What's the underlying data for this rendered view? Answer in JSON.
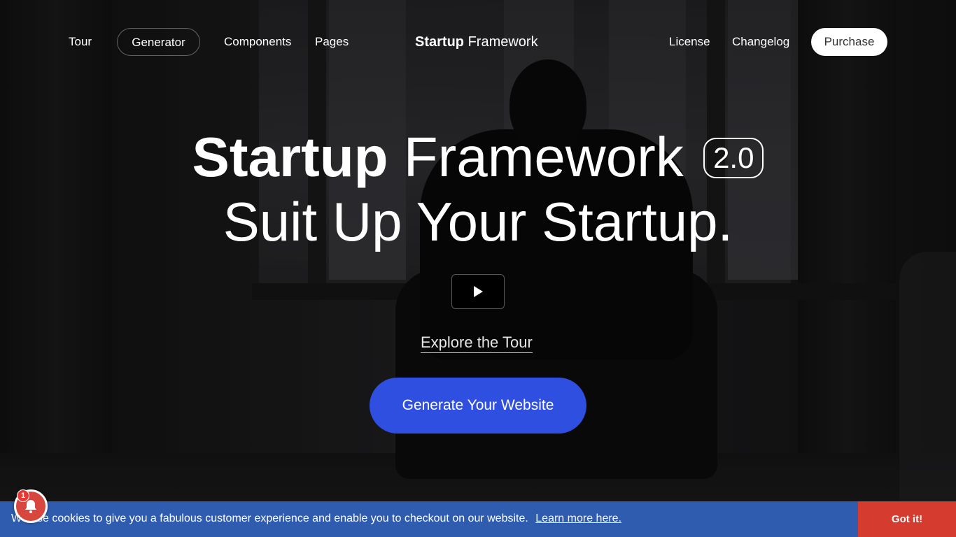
{
  "nav": {
    "left": [
      {
        "label": "Tour"
      },
      {
        "label": "Generator"
      },
      {
        "label": "Components"
      },
      {
        "label": "Pages"
      }
    ],
    "brand_bold": "Startup",
    "brand_light": "Framework",
    "right": [
      {
        "label": "License"
      },
      {
        "label": "Changelog"
      }
    ],
    "purchase_label": "Purchase"
  },
  "hero": {
    "title_bold": "Startup",
    "title_light": "Framework",
    "version": "2.0",
    "subtitle": "Suit Up Your Startup.",
    "play_icon": "play-icon",
    "explore_label": "Explore the Tour",
    "cta_label": "Generate Your Website"
  },
  "cookie": {
    "text": "We use cookies to give you a fabulous customer experience and enable you to checkout on our website.",
    "link_label": "Learn more here.",
    "button_label": "Got it!"
  },
  "notification": {
    "icon": "bell-icon",
    "count": "1"
  },
  "colors": {
    "cta": "#2f4fe0",
    "cookie_bar": "#2f5cae",
    "cookie_button": "#d63b2f",
    "bell": "#d8473d"
  }
}
